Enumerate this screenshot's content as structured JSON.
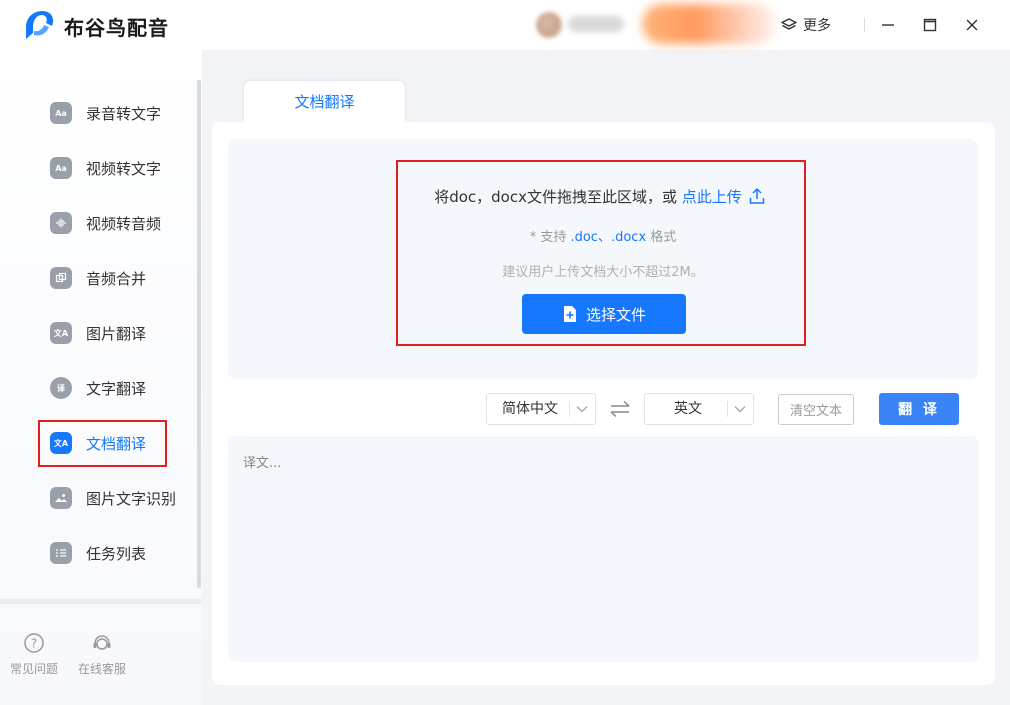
{
  "app": {
    "title": "布谷鸟配音",
    "brand_color": "#1677ff"
  },
  "header": {
    "more_label": "更多"
  },
  "sidebar": {
    "items": [
      {
        "label": "录音转文字",
        "icon": "audio-to-text-icon"
      },
      {
        "label": "视频转文字",
        "icon": "video-to-text-icon"
      },
      {
        "label": "视频转音频",
        "icon": "video-to-audio-icon"
      },
      {
        "label": "音频合并",
        "icon": "audio-merge-icon"
      },
      {
        "label": "图片翻译",
        "icon": "image-translate-icon"
      },
      {
        "label": "文字翻译",
        "icon": "text-translate-icon"
      },
      {
        "label": "文档翻译",
        "icon": "document-translate-icon",
        "active": true
      },
      {
        "label": "图片文字识别",
        "icon": "image-ocr-icon"
      },
      {
        "label": "任务列表",
        "icon": "task-list-icon"
      }
    ],
    "footer": {
      "faq_label": "常见问题",
      "support_label": "在线客服"
    }
  },
  "main": {
    "tab_label": "文档翻译",
    "upload": {
      "prompt": "将doc，docx文件拖拽至此区域，或",
      "link_label": "点此上传",
      "formats_prefix": "* 支持",
      "formats_value": ".doc、.docx",
      "formats_suffix": "格式",
      "size_hint": "建议用户上传文档大小不超过2M。",
      "choose_button": "选择文件"
    },
    "source_language": "简体中文",
    "target_language": "英文",
    "clear_button": "清空文本",
    "translate_button": "翻 译",
    "output_placeholder": "译文..."
  }
}
